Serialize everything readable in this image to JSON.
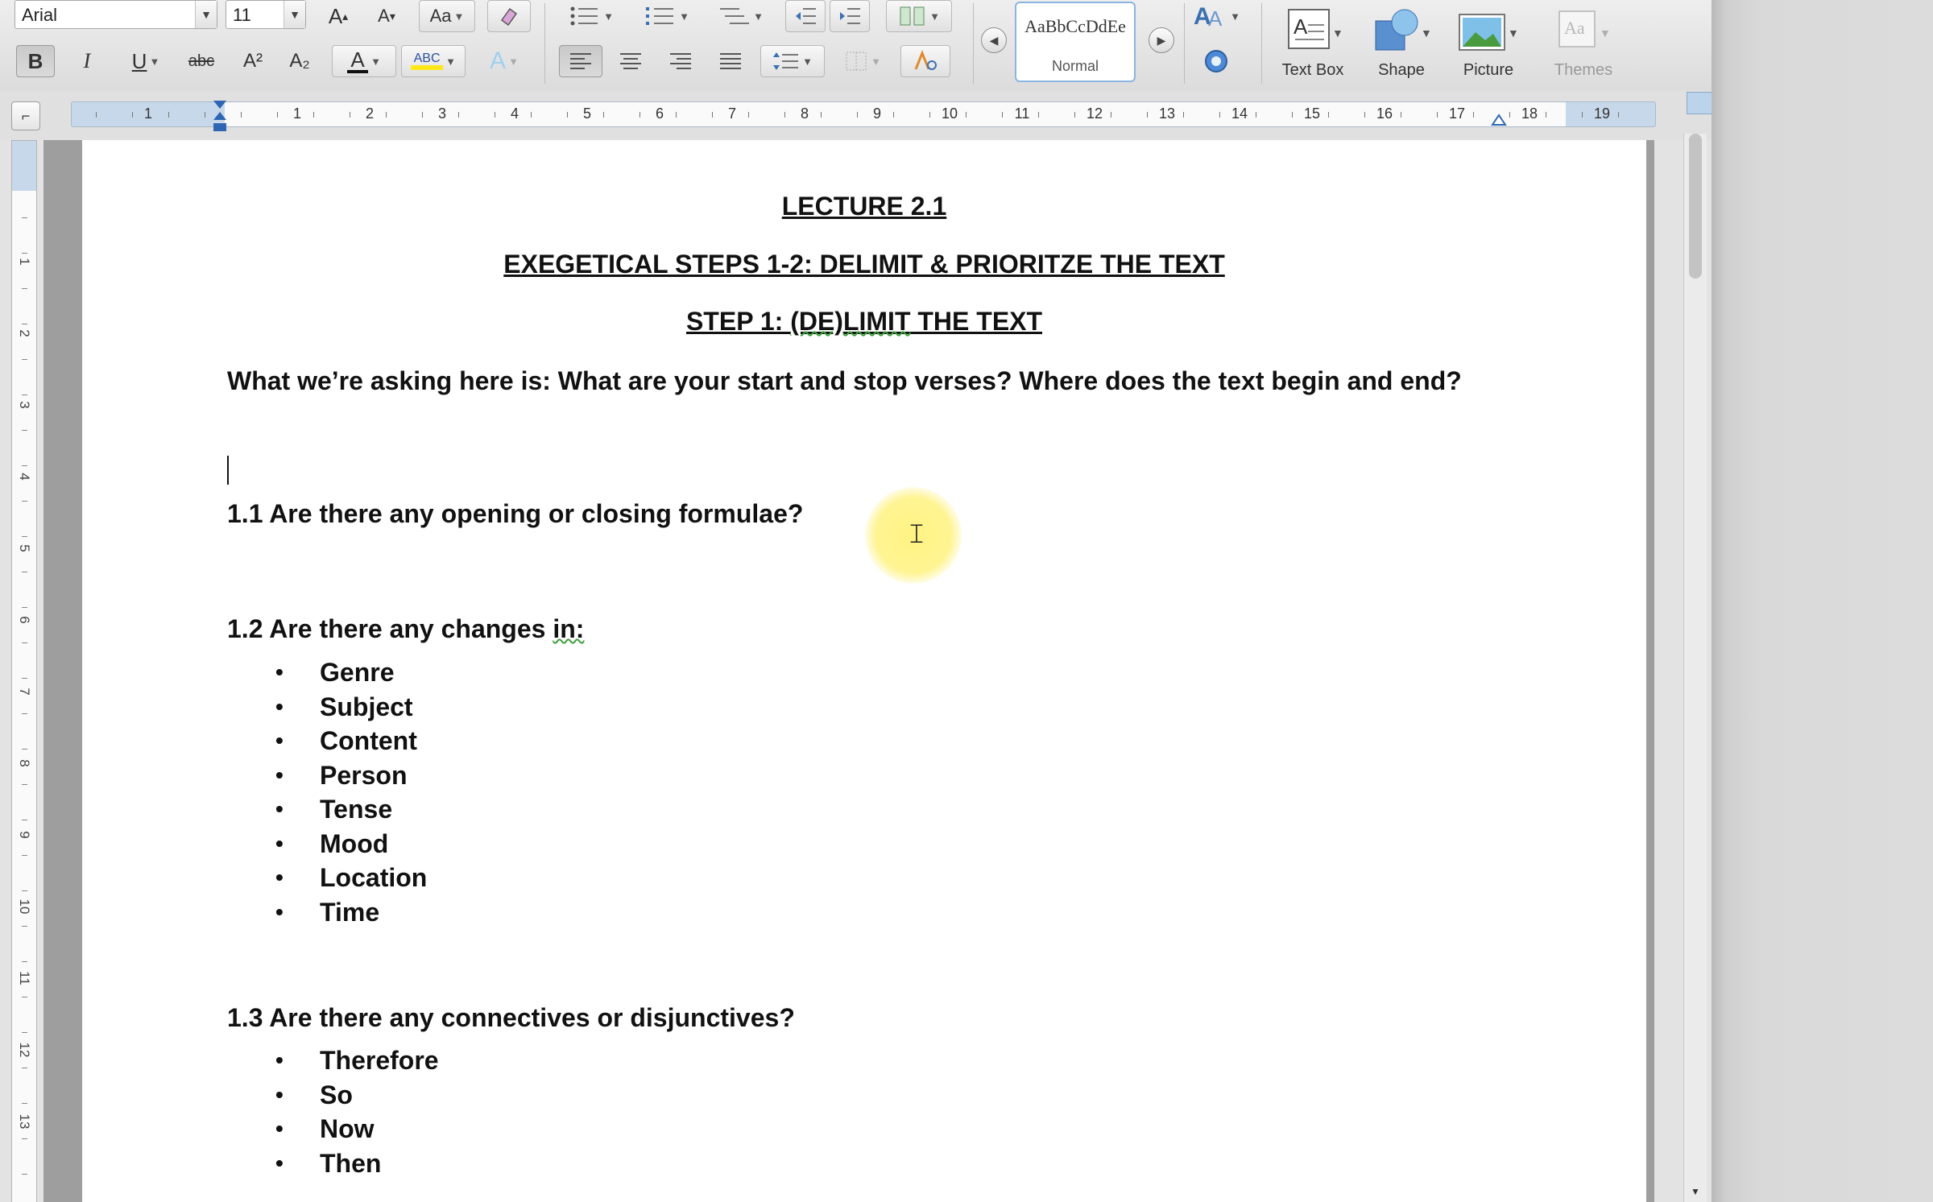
{
  "toolbar": {
    "font_name": "Arial",
    "font_size": "11",
    "styles_preview": "AaBbCcDdEe",
    "styles_name": "Normal",
    "text_box_label": "Text Box",
    "shape_label": "Shape",
    "picture_label": "Picture",
    "themes_label": "Themes",
    "bold": "B",
    "italic": "I",
    "underline": "U",
    "strikethrough": "abc",
    "superscript": "A²",
    "subscript": "A₂",
    "font_color": "A",
    "highlight": "ABC",
    "grow_font": "A",
    "shrink_font": "A",
    "change_case": "Aa"
  },
  "ruler": {
    "numbers": [
      "1",
      "1",
      "2",
      "3",
      "4",
      "5",
      "6",
      "7",
      "8",
      "9",
      "10",
      "11",
      "12",
      "13",
      "14",
      "15",
      "16",
      "17",
      "18",
      "19"
    ]
  },
  "vruler": {
    "numbers": [
      "1",
      "2",
      "3",
      "4",
      "5",
      "6",
      "7",
      "8",
      "9",
      "10",
      "11",
      "12",
      "13"
    ]
  },
  "document": {
    "title": "LECTURE 2.1",
    "subtitle": "EXEGETICAL STEPS 1-2: DELIMIT & PRIORITZE THE TEXT",
    "step_heading_prefix": "STEP 1: ",
    "step_heading_word": "(DE)LIMIT",
    "step_heading_suffix": " THE TEXT",
    "intro": "What we’re asking here is: What are your start and stop verses? Where does the text begin and end?",
    "q1": "1.1 Are there any opening or closing formulae?",
    "q2_prefix": "1.2 Are there any changes ",
    "q2_word": "in:",
    "list1": [
      "Genre",
      "Subject",
      "Content",
      "Person",
      "Tense",
      "Mood",
      "Location",
      "Time"
    ],
    "q3": "1.3 Are there any connectives or disjunctives?",
    "list2": [
      "Therefore",
      "So",
      "Now",
      "Then"
    ]
  },
  "colors": {
    "ruler_blue": "#c7d8ea",
    "styles_border": "#8bb4e0",
    "pointer_halo": "#fff278",
    "spell_squiggle": "#3ca03c"
  }
}
